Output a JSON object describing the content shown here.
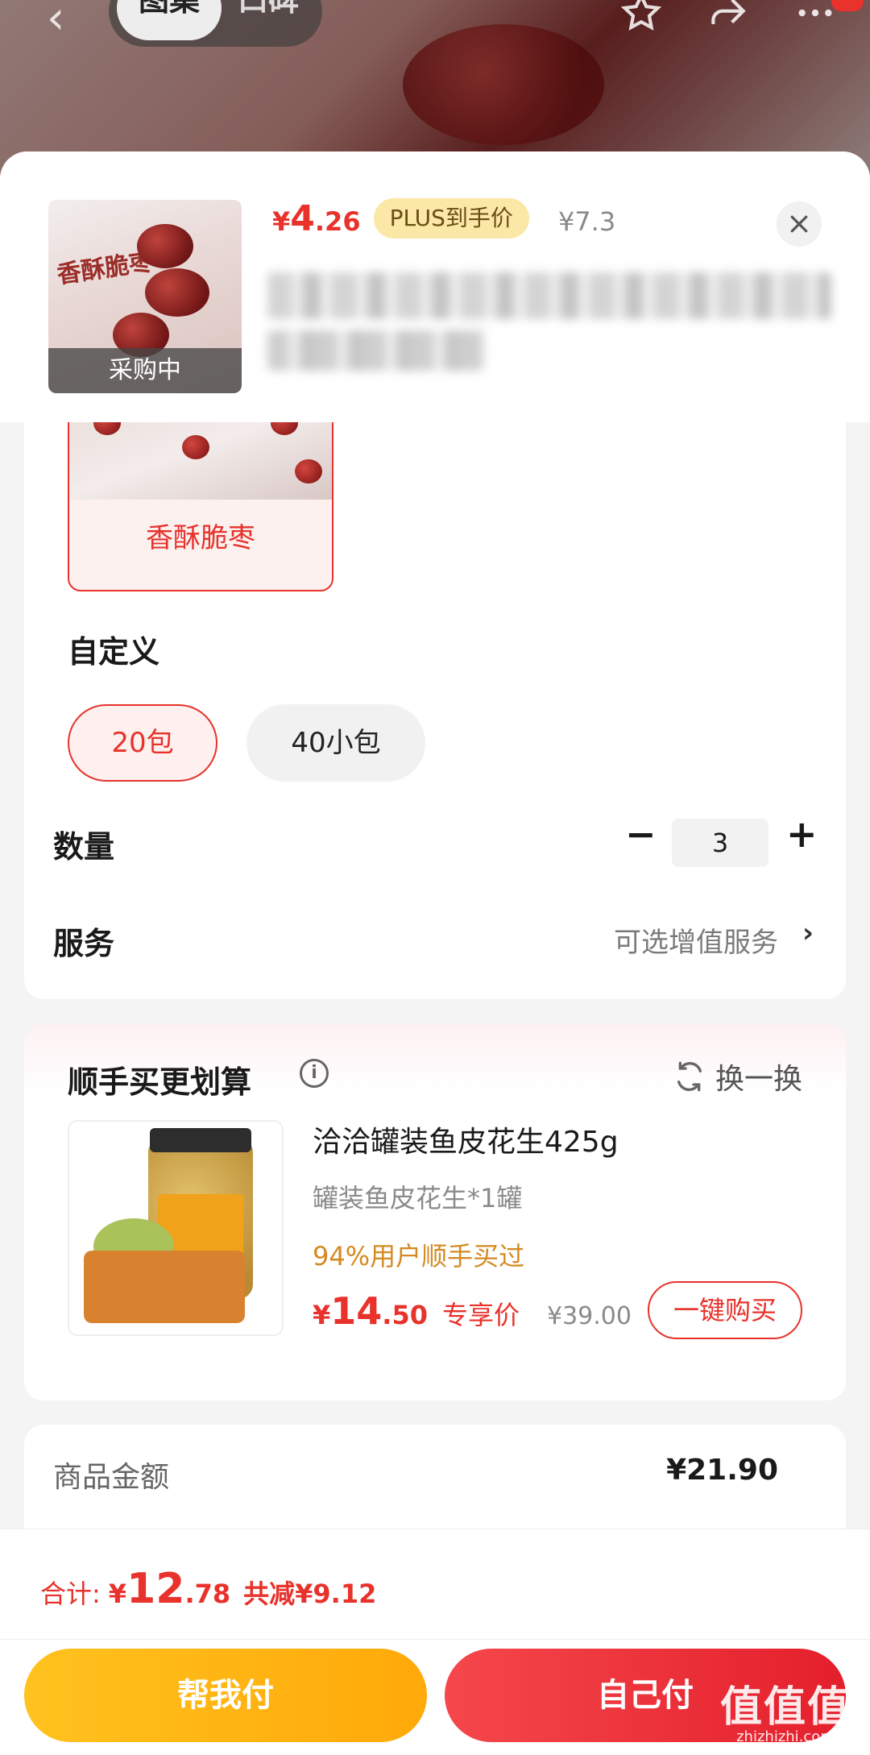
{
  "background": {
    "tabs": [
      "图集",
      "口碑"
    ]
  },
  "header": {
    "price_yen": "¥",
    "price_int": "4",
    "price_dec": ".26",
    "plus_badge": "PLUS到手价",
    "original_price": "¥7.3",
    "thumb_brand": "香酥脆枣",
    "thumb_status": "采购中"
  },
  "options": {
    "flavor_label": "香酥脆枣",
    "custom_title": "自定义",
    "custom_options": [
      "20包",
      "40小包"
    ],
    "selected_custom": "20包",
    "quantity_label": "数量",
    "quantity_minus": "−",
    "quantity_value": "3",
    "quantity_plus": "+",
    "service_label": "服务",
    "service_hint": "可选增值服务",
    "service_chevron": "›"
  },
  "recommendation": {
    "title": "顺手买更划算",
    "info_glyph": "i",
    "refresh_label": "换一换",
    "product_name": "洽洽罐装鱼皮花生425g",
    "spec": "罐装鱼皮花生*1罐",
    "stat": "94%用户顺手买过",
    "price_yen": "¥",
    "price_int": "14",
    "price_dec": ".50",
    "price_tag": "专享价",
    "original_price": "¥39.00",
    "buy_button": "一键购买"
  },
  "amount": {
    "label": "商品金额",
    "value": "¥21.90"
  },
  "bottom_bar": {
    "total_label": "合计:",
    "total_yen": "¥",
    "total_int": "12",
    "total_dec": ".78",
    "total_saving": "共减¥9.12",
    "friend_pay": "帮我付",
    "self_pay": "自己付"
  },
  "watermark": {
    "big": "值值值",
    "small": "zhizhizhi.com"
  },
  "colors": {
    "accent": "#e8322b",
    "plus_badge_bg": "#fbe7a6",
    "friend_pay_bg": "#ffb414",
    "self_pay_bg": "#ec2f38"
  }
}
